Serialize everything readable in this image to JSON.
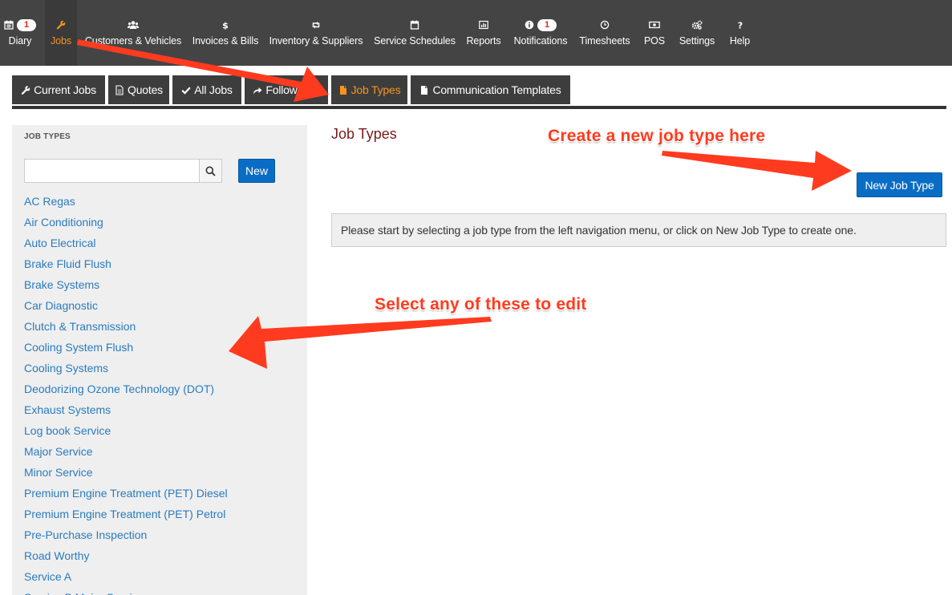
{
  "topnav": {
    "items": [
      {
        "label": "Diary",
        "icon": "calendar-icon",
        "badge": "1"
      },
      {
        "label": "Jobs",
        "icon": "wrench-icon",
        "active": true
      },
      {
        "label": "Customers & Vehicles",
        "icon": "users-icon"
      },
      {
        "label": "Invoices & Bills",
        "icon": "dollar-icon"
      },
      {
        "label": "Inventory & Suppliers",
        "icon": "retweet-icon"
      },
      {
        "label": "Service Schedules",
        "icon": "calendar-icon"
      },
      {
        "label": "Reports",
        "icon": "bar-chart-icon"
      },
      {
        "label": "Notifications",
        "icon": "info-icon",
        "badge": "1"
      },
      {
        "label": "Timesheets",
        "icon": "clock-icon"
      },
      {
        "label": "POS",
        "icon": "money-icon"
      },
      {
        "label": "Settings",
        "icon": "gears-icon"
      },
      {
        "label": "Help",
        "icon": "question-icon"
      }
    ]
  },
  "tabs": [
    {
      "label": "Current Jobs",
      "icon": "wrench-icon"
    },
    {
      "label": "Quotes",
      "icon": "file-icon"
    },
    {
      "label": "All Jobs",
      "icon": "check-icon"
    },
    {
      "label": "Follow Ups",
      "icon": "share-icon"
    },
    {
      "label": "Job Types",
      "icon": "file-icon",
      "active": true
    },
    {
      "label": "Communication Templates",
      "icon": "file-icon"
    }
  ],
  "sidebar": {
    "heading": "JOB TYPES",
    "search_value": "",
    "search_placeholder": "",
    "new_label": "New",
    "job_types": [
      "AC Regas",
      "Air Conditioning",
      "Auto Electrical",
      "Brake Fluid Flush",
      "Brake Systems",
      "Car Diagnostic",
      "Clutch & Transmission",
      "Cooling System Flush",
      "Cooling Systems",
      "Deodorizing Ozone Technology (DOT)",
      "Exhaust Systems",
      "Log book Service",
      "Major Service",
      "Minor Service",
      "Premium Engine Treatment (PET) Diesel",
      "Premium Engine Treatment (PET) Petrol",
      "Pre-Purchase Inspection",
      "Road Worthy",
      "Service A",
      "Service B Major Service"
    ]
  },
  "main": {
    "title": "Job Types",
    "new_button_label": "New Job Type",
    "info_message": "Please start by selecting a job type from the left navigation menu, or click on New Job Type to create one."
  },
  "annotations": {
    "create_text": "Create a new job type here",
    "select_text": "Select any of these to edit",
    "arrow_color": "#ff3b1f"
  },
  "colors": {
    "nav_bg": "#444444",
    "active_orange": "#f7941d",
    "link_blue": "#2a7bbf",
    "button_blue": "#0a6dc5",
    "title_maroon": "#7a1a1a"
  }
}
